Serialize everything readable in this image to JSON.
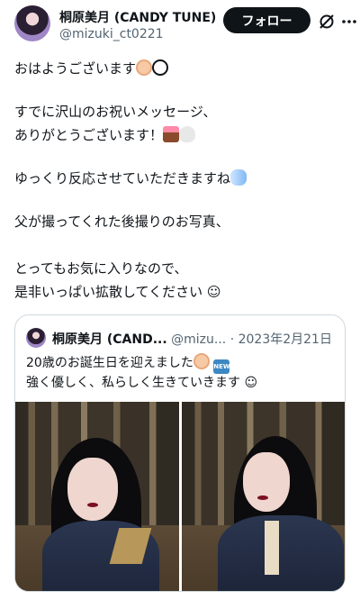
{
  "author": {
    "display_name": "桐原美月 (CANDY TUNE)",
    "handle": "@mizuki_ct0221"
  },
  "actions": {
    "follow_label": "フォロー",
    "grok_icon": "grok-slash-circle-icon",
    "more_icon": "more-dots-icon"
  },
  "tweet": {
    "lines": [
      "おはようございます",
      "すでに沢山のお祝いメッセージ、",
      "ありがとうございます！",
      "ゆっくり反応させていただきますね",
      "父が撮ってくれた後撮りのお写真、",
      "とってもお気に入りなので、",
      "是非いっぱい拡散してください ☺"
    ]
  },
  "quote": {
    "display_name": "桐原美月 (CAND...",
    "handle": "@mizu...",
    "separator": "·",
    "date": "2023年2月21日",
    "lines": [
      "20歳のお誕生日を迎えました",
      "強く優しく、私らしく生きていきます ☺"
    ],
    "new_badge": "NEW"
  },
  "colors": {
    "text": "#0f1419",
    "secondary": "#536471",
    "border": "#cfd9de",
    "follow_bg": "#0f1419"
  }
}
